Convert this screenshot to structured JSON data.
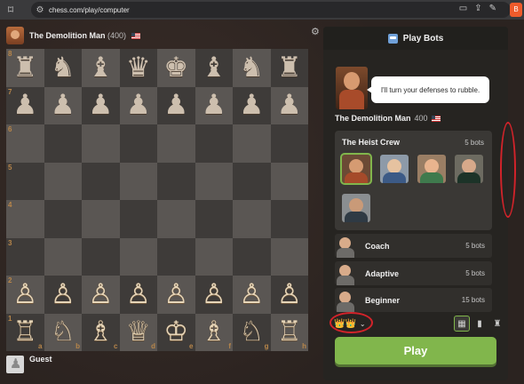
{
  "browser": {
    "url": "chess.com/play/computer"
  },
  "top_player": {
    "name": "The Demolition Man",
    "rating": "(400)"
  },
  "bottom_player": {
    "name": "Guest"
  },
  "board": {
    "ranks": [
      "8",
      "7",
      "6",
      "5",
      "4",
      "3",
      "2",
      "1"
    ],
    "files": [
      "a",
      "b",
      "c",
      "d",
      "e",
      "f",
      "g",
      "h"
    ],
    "rows": [
      [
        "♜",
        "♞",
        "♝",
        "♛",
        "♚",
        "♝",
        "♞",
        "♜"
      ],
      [
        "♟",
        "♟",
        "♟",
        "♟",
        "♟",
        "♟",
        "♟",
        "♟"
      ],
      [
        "",
        "",
        "",
        "",
        "",
        "",
        "",
        ""
      ],
      [
        "",
        "",
        "",
        "",
        "",
        "",
        "",
        ""
      ],
      [
        "",
        "",
        "",
        "",
        "",
        "",
        "",
        ""
      ],
      [
        "",
        "",
        "",
        "",
        "",
        "",
        "",
        ""
      ],
      [
        "♙",
        "♙",
        "♙",
        "♙",
        "♙",
        "♙",
        "♙",
        "♙"
      ],
      [
        "♖",
        "♘",
        "♗",
        "♕",
        "♔",
        "♗",
        "♘",
        "♖"
      ]
    ]
  },
  "panel": {
    "title": "Play Bots",
    "speech": "I'll turn your defenses to rubble.",
    "bot_name": "The Demolition Man",
    "bot_rating": "400",
    "group": {
      "title": "The Heist Crew",
      "count": "5 bots"
    },
    "rows": [
      {
        "label": "Coach",
        "count": "5 bots"
      },
      {
        "label": "Adaptive",
        "count": "5 bots"
      },
      {
        "label": "Beginner",
        "count": "15 bots"
      }
    ],
    "play_label": "Play",
    "crowns": "👑👑",
    "colors": {
      "accent_green": "#81b64c",
      "annotation_red": "#d2232a"
    }
  }
}
